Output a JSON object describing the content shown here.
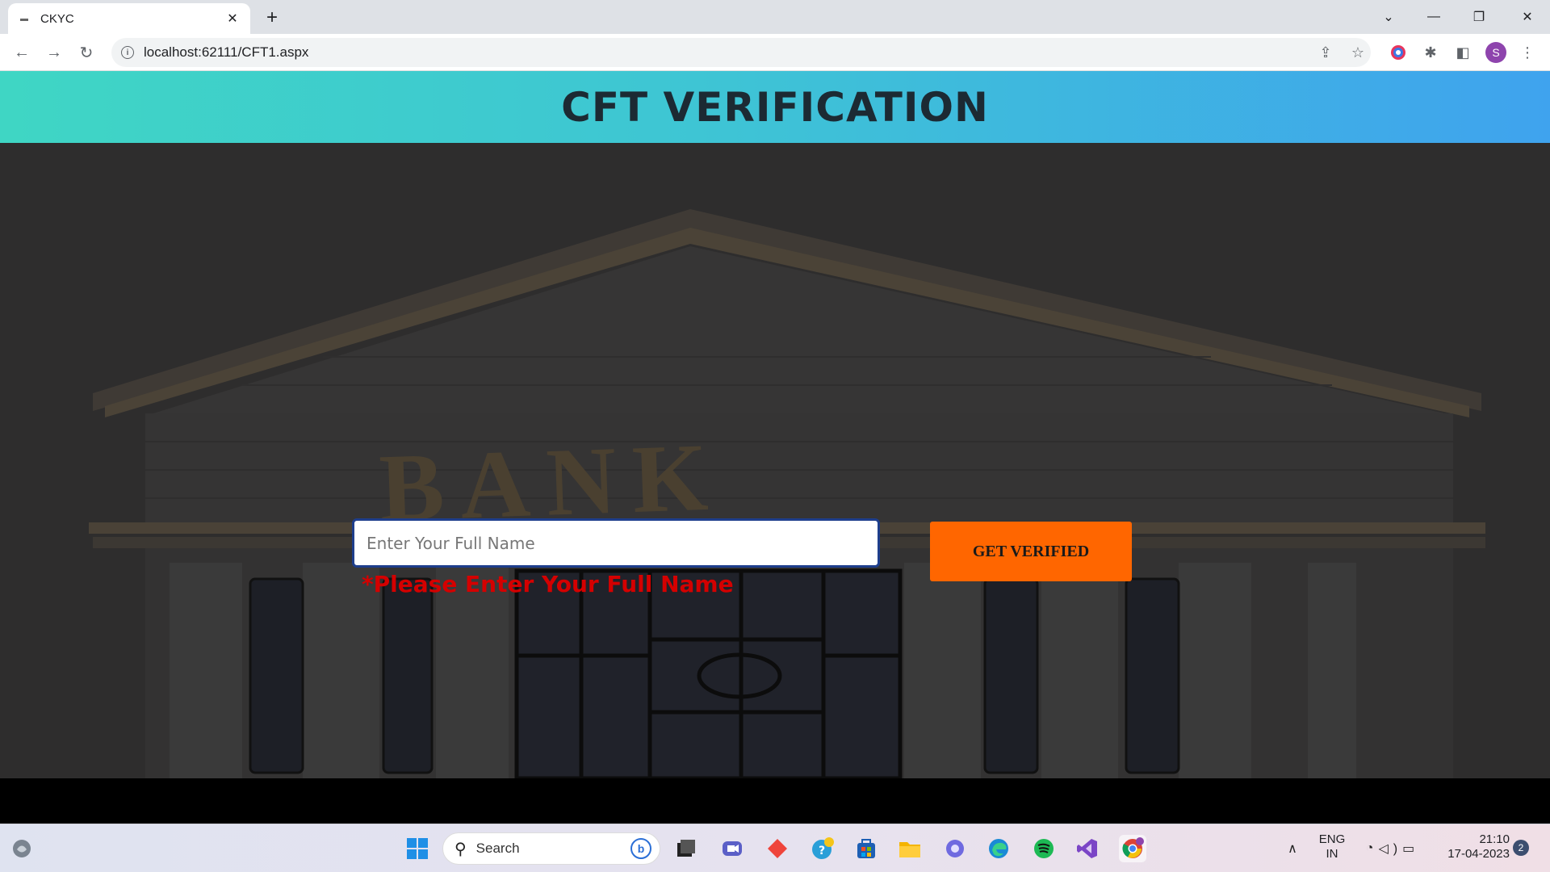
{
  "browser": {
    "tab_title": "CKYC",
    "url": "localhost:62111/CFT1.aspx",
    "profile_initial": "S"
  },
  "page": {
    "header_title": "CFT VERIFICATION",
    "name_input": {
      "placeholder": "Enter Your Full Name",
      "value": ""
    },
    "error_message": "*Please Enter Your Full Name",
    "verify_button": "GET VERIFIED",
    "background_sign": "BANK"
  },
  "taskbar": {
    "search_label": "Search",
    "language_line1": "ENG",
    "language_line2": "IN",
    "time": "21:10",
    "date": "17-04-2023",
    "notification_count": "2"
  },
  "colors": {
    "header_gradient_start": "#3fd6c4",
    "header_gradient_end": "#3fa3ee",
    "button_orange": "#ff6600",
    "error_red": "#d40000",
    "input_border": "#1e3e8c"
  }
}
